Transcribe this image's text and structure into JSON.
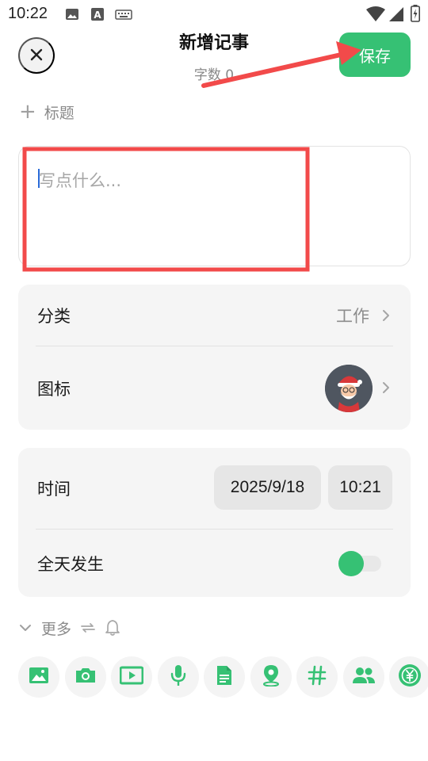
{
  "status_bar": {
    "time": "10:22",
    "left_icons": [
      "image-icon",
      "font-a-icon",
      "keyboard-icon"
    ],
    "right_icons": [
      "wifi-icon",
      "signal-icon",
      "battery-charging-icon"
    ]
  },
  "header": {
    "title": "新增记事",
    "word_count": "字数 0",
    "save_label": "保存",
    "close_icon": "close-icon"
  },
  "title_field": {
    "plus": "+",
    "placeholder": "标题"
  },
  "content_field": {
    "placeholder": "写点什么..."
  },
  "settings_card": {
    "category_label": "分类",
    "category_value": "工作",
    "icon_label": "图标",
    "icon_avatar": "santa-avatar"
  },
  "time_card": {
    "time_label": "时间",
    "date_value": "2025/9/18",
    "time_value": "10:21",
    "all_day_label": "全天发生",
    "all_day_on": false
  },
  "more": {
    "label": "更多",
    "icons": [
      "chevron-down-icon",
      "repeat-icon",
      "bell-icon"
    ]
  },
  "toolbar": {
    "icons": [
      "gallery-icon",
      "camera-icon",
      "video-icon",
      "microphone-icon",
      "document-icon",
      "location-icon",
      "hashtag-icon",
      "people-icon",
      "yuan-coin-icon"
    ]
  },
  "colors": {
    "accent": "#36c174",
    "card_bg": "#f5f5f5",
    "annotation_red": "#f24a4a"
  }
}
